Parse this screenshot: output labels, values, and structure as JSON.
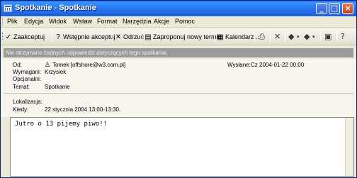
{
  "window": {
    "title": "Spotkanie - Spotkanie",
    "controls": {
      "minimize": "_",
      "maximize": "□",
      "close": "×"
    }
  },
  "menu": {
    "items": [
      "Plik",
      "Edycja",
      "Widok",
      "Wstaw",
      "Format",
      "Narzędzia",
      "Akcje",
      "Pomoc"
    ]
  },
  "toolbar": {
    "accept": "Zaakceptuj",
    "tentative": "Wstępnie akceptuj",
    "decline": "Odrzuć",
    "propose": "Zaproponuj nowy termin",
    "calendar": "Kalendarz..."
  },
  "infobar": {
    "text": "Nie otrzymano żadnych odpowiedzi dotyczących tego spotkania."
  },
  "header": {
    "from_label": "Od:",
    "from_value": "Tomek [offshore@w3.com.pl]",
    "sent_label": "Wysłane:",
    "sent_value": "Cz 2004-01-22 00:00",
    "required_label": "Wymagani:",
    "required_value": "Krzysiek",
    "optional_label": "Opcjonalni:",
    "subject_label": "Temat:",
    "subject_value": "Spotkanie",
    "location_label": "Lokalizacja:",
    "when_label": "Kiedy:",
    "when_value": "22 stycznia 2004 13:00-13:30."
  },
  "body": {
    "text": "Jutro o 13 pijemy piwo!!"
  }
}
